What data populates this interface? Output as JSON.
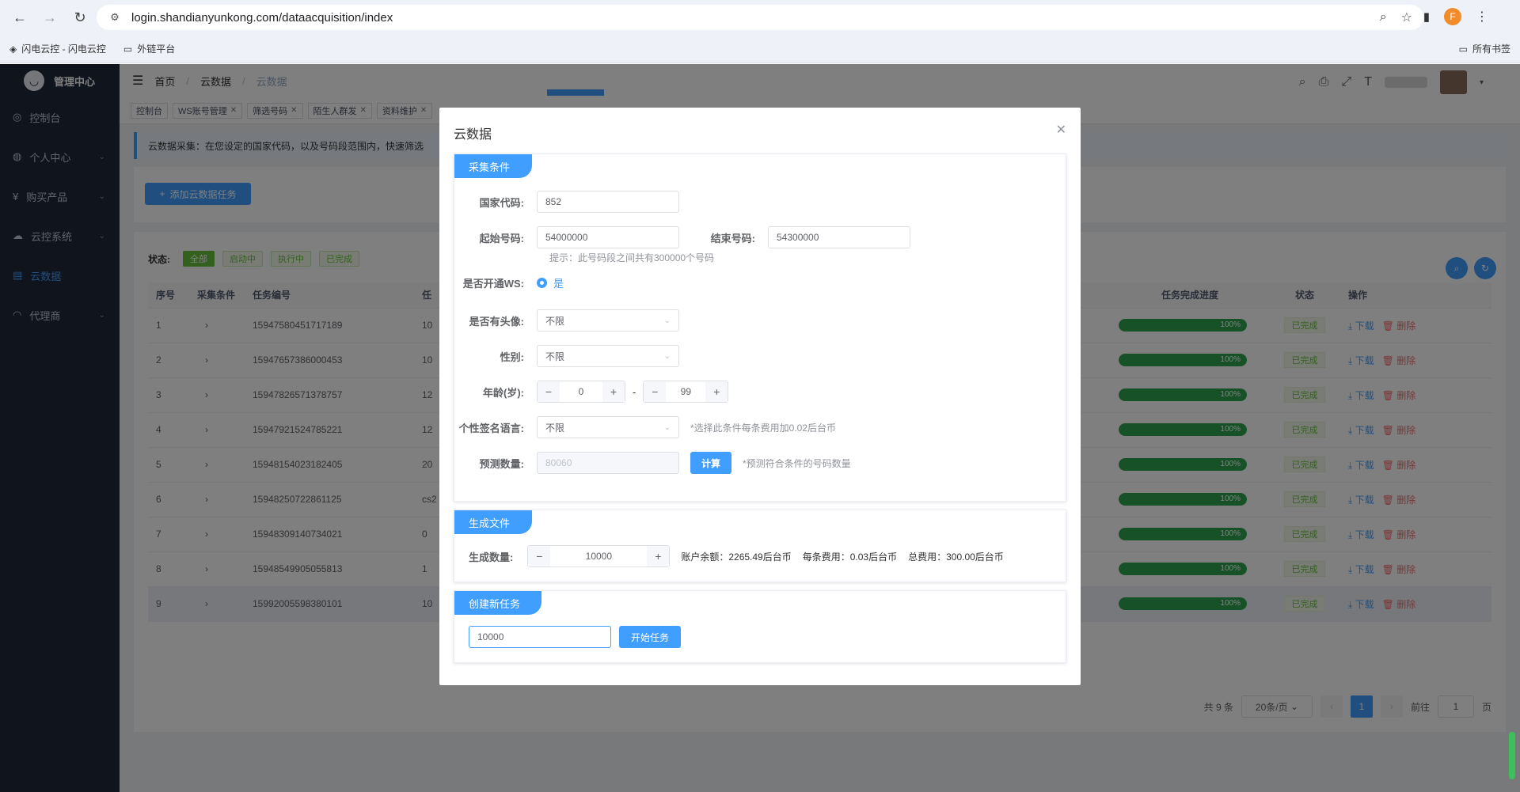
{
  "browser": {
    "url": "login.shandianyunkong.com/dataacquisition/index",
    "profile_initial": "F",
    "bookmarks": [
      "闪电云控 - 闪电云控",
      "外链平台"
    ],
    "all_bookmarks": "所有书签"
  },
  "sidebar": {
    "brand": "管理中心",
    "items": [
      {
        "label": "控制台",
        "icon": "dashboard-icon"
      },
      {
        "label": "个人中心",
        "icon": "user-icon"
      },
      {
        "label": "购买产品",
        "icon": "yen-icon"
      },
      {
        "label": "云控系统",
        "icon": "cloud-control-icon"
      },
      {
        "label": "云数据",
        "icon": "database-icon"
      },
      {
        "label": "代理商",
        "icon": "agent-icon"
      }
    ]
  },
  "header": {
    "breadcrumb": [
      "首页",
      "云数据",
      "云数据"
    ]
  },
  "tags": [
    "控制台",
    "WS账号管理",
    "筛选号码",
    "陌生人群发",
    "资料维护"
  ],
  "tip": "云数据采集：在您设定的国家代码，以及号码段范围内，快速筛选",
  "add_button": "添加云数据任务",
  "status_filter": {
    "label": "状态:",
    "options": [
      "全部",
      "启动中",
      "执行中",
      "已完成"
    ]
  },
  "table": {
    "columns": [
      "序号",
      "采集条件",
      "任务编号",
      "任",
      "任务完成进度",
      "状态",
      "操作"
    ],
    "rows": [
      {
        "no": "1",
        "task_id": "15947580451717189",
        "c4": "10",
        "progress": "100%",
        "status": "已完成"
      },
      {
        "no": "2",
        "task_id": "15947657386000453",
        "c4": "10",
        "progress": "100%",
        "status": "已完成"
      },
      {
        "no": "3",
        "task_id": "15947826571378757",
        "c4": "12",
        "progress": "100%",
        "status": "已完成"
      },
      {
        "no": "4",
        "task_id": "15947921524785221",
        "c4": "12",
        "progress": "100%",
        "status": "已完成"
      },
      {
        "no": "5",
        "task_id": "15948154023182405",
        "c4": "20",
        "progress": "100%",
        "status": "已完成"
      },
      {
        "no": "6",
        "task_id": "15948250722861125",
        "c4": "cs2",
        "progress": "100%",
        "status": "已完成"
      },
      {
        "no": "7",
        "task_id": "15948309140734021",
        "c4": "0",
        "progress": "100%",
        "status": "已完成"
      },
      {
        "no": "8",
        "task_id": "15948549905055813",
        "c4": "1",
        "progress": "100%",
        "status": "已完成"
      },
      {
        "no": "9",
        "task_id": "15992005598380101",
        "c4": "10",
        "progress": "100%",
        "status": "已完成"
      }
    ],
    "download_label": "下载",
    "delete_label": "删除"
  },
  "pager": {
    "total": "共 9 条",
    "page_size": "20条/页",
    "current": "1",
    "goto_label": "前往",
    "goto_value": "1",
    "page_unit": "页"
  },
  "dialog": {
    "title": "云数据",
    "collect": {
      "head": "采集条件",
      "country_label": "国家代码:",
      "country_value": "852",
      "start_label": "起始号码:",
      "start_value": "54000000",
      "end_label": "结束号码:",
      "end_value": "54300000",
      "range_hint": "提示：此号码段之间共有300000个号码",
      "ws_label": "是否开通WS:",
      "ws_value": "是",
      "avatar_label": "是否有头像:",
      "avatar_value": "不限",
      "gender_label": "性别:",
      "gender_value": "不限",
      "age_label": "年龄(岁):",
      "age_min": "0",
      "age_max": "99",
      "age_sep": "-",
      "sign_label": "个性签名语言:",
      "sign_value": "不限",
      "sign_hint": "*选择此条件每条费用加0.02后台币",
      "estimate_label": "预测数量:",
      "estimate_value": "80060",
      "calc_button": "计算",
      "estimate_hint": "*预测符合条件的号码数量"
    },
    "generate": {
      "head": "生成文件",
      "count_label": "生成数量:",
      "count_value": "10000",
      "balance": "账户余额：2265.49后台币",
      "unit_cost": "每条费用：0.03后台币",
      "total_cost": "总费用：300.00后台币"
    },
    "create": {
      "head": "创建新任务",
      "input_value": "10000",
      "start_button": "开始任务"
    }
  }
}
